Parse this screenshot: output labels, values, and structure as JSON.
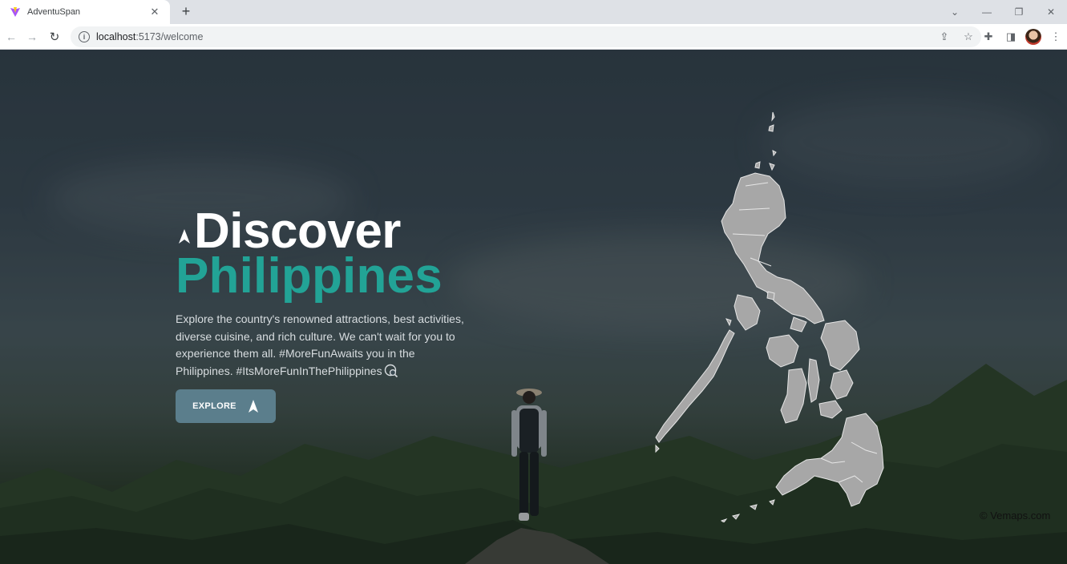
{
  "browser": {
    "tab_title": "AdventuSpan",
    "url_host": "localhost",
    "url_path": ":5173/welcome"
  },
  "hero": {
    "title_line1": "Discover",
    "title_line2": "Philippines",
    "description": "Explore the country's renowned attractions, best activities, diverse cuisine, and rich culture. We can't wait for you to experience them all. #MoreFunAwaits you in the Philippines. #ItsMoreFunInThePhilippines",
    "explore_label": "EXPLORE"
  },
  "map": {
    "credit": "© Vemaps.com"
  },
  "colors": {
    "accent_teal": "#22a396",
    "button_bg": "#5b7e8c",
    "map_fill": "#a7a7a7"
  },
  "icons": {
    "favicon": "vite-icon",
    "title_arrow": "navigation-arrow-icon",
    "desc_icon": "search-location-icon",
    "button_arrow": "navigation-arrow-icon"
  }
}
